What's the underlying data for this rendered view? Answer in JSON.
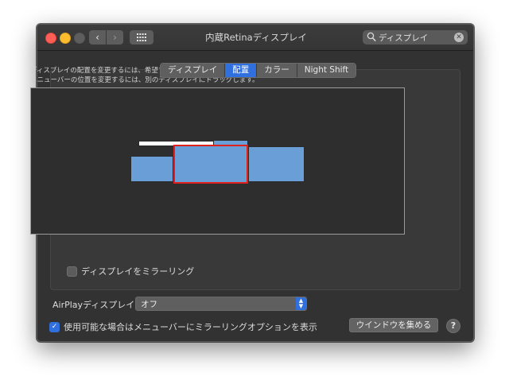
{
  "window": {
    "title": "内蔵Retinaディスプレイ"
  },
  "toolbar": {
    "back_icon": "chevron-left-icon",
    "forward_icon": "chevron-right-icon",
    "grid_icon": "show-all-grid-icon"
  },
  "search": {
    "value": "ディスプレイ",
    "icon": "search-icon",
    "clear_icon": "clear-icon"
  },
  "tabs": [
    {
      "label": "ディスプレイ",
      "active": false
    },
    {
      "label": "配置",
      "active": true
    },
    {
      "label": "カラー",
      "active": false
    },
    {
      "label": "Night Shift",
      "active": false
    }
  ],
  "arrangement": {
    "instruction_1": "ディスプレイの配置を変更するには、希望する場所にドラッグします。",
    "instruction_2": "メニューバーの位置を変更するには、別のディスプレイにドラッグします。",
    "display_color": "#6a9ed6",
    "selected_border_color": "#e0201b",
    "menubar_color": "#ffffff"
  },
  "mirror": {
    "label": "ディスプレイをミラーリング",
    "checked": false
  },
  "airplay": {
    "label": "AirPlayディスプレイ:",
    "value": "オフ"
  },
  "show_options": {
    "label": "使用可能な場合はメニューバーにミラーリングオプションを表示",
    "checked": true
  },
  "gather_button": {
    "label": "ウインドウを集める"
  },
  "help_button": {
    "label": "?"
  },
  "colors": {
    "accent": "#2f6fde",
    "window_bg": "#323232"
  }
}
